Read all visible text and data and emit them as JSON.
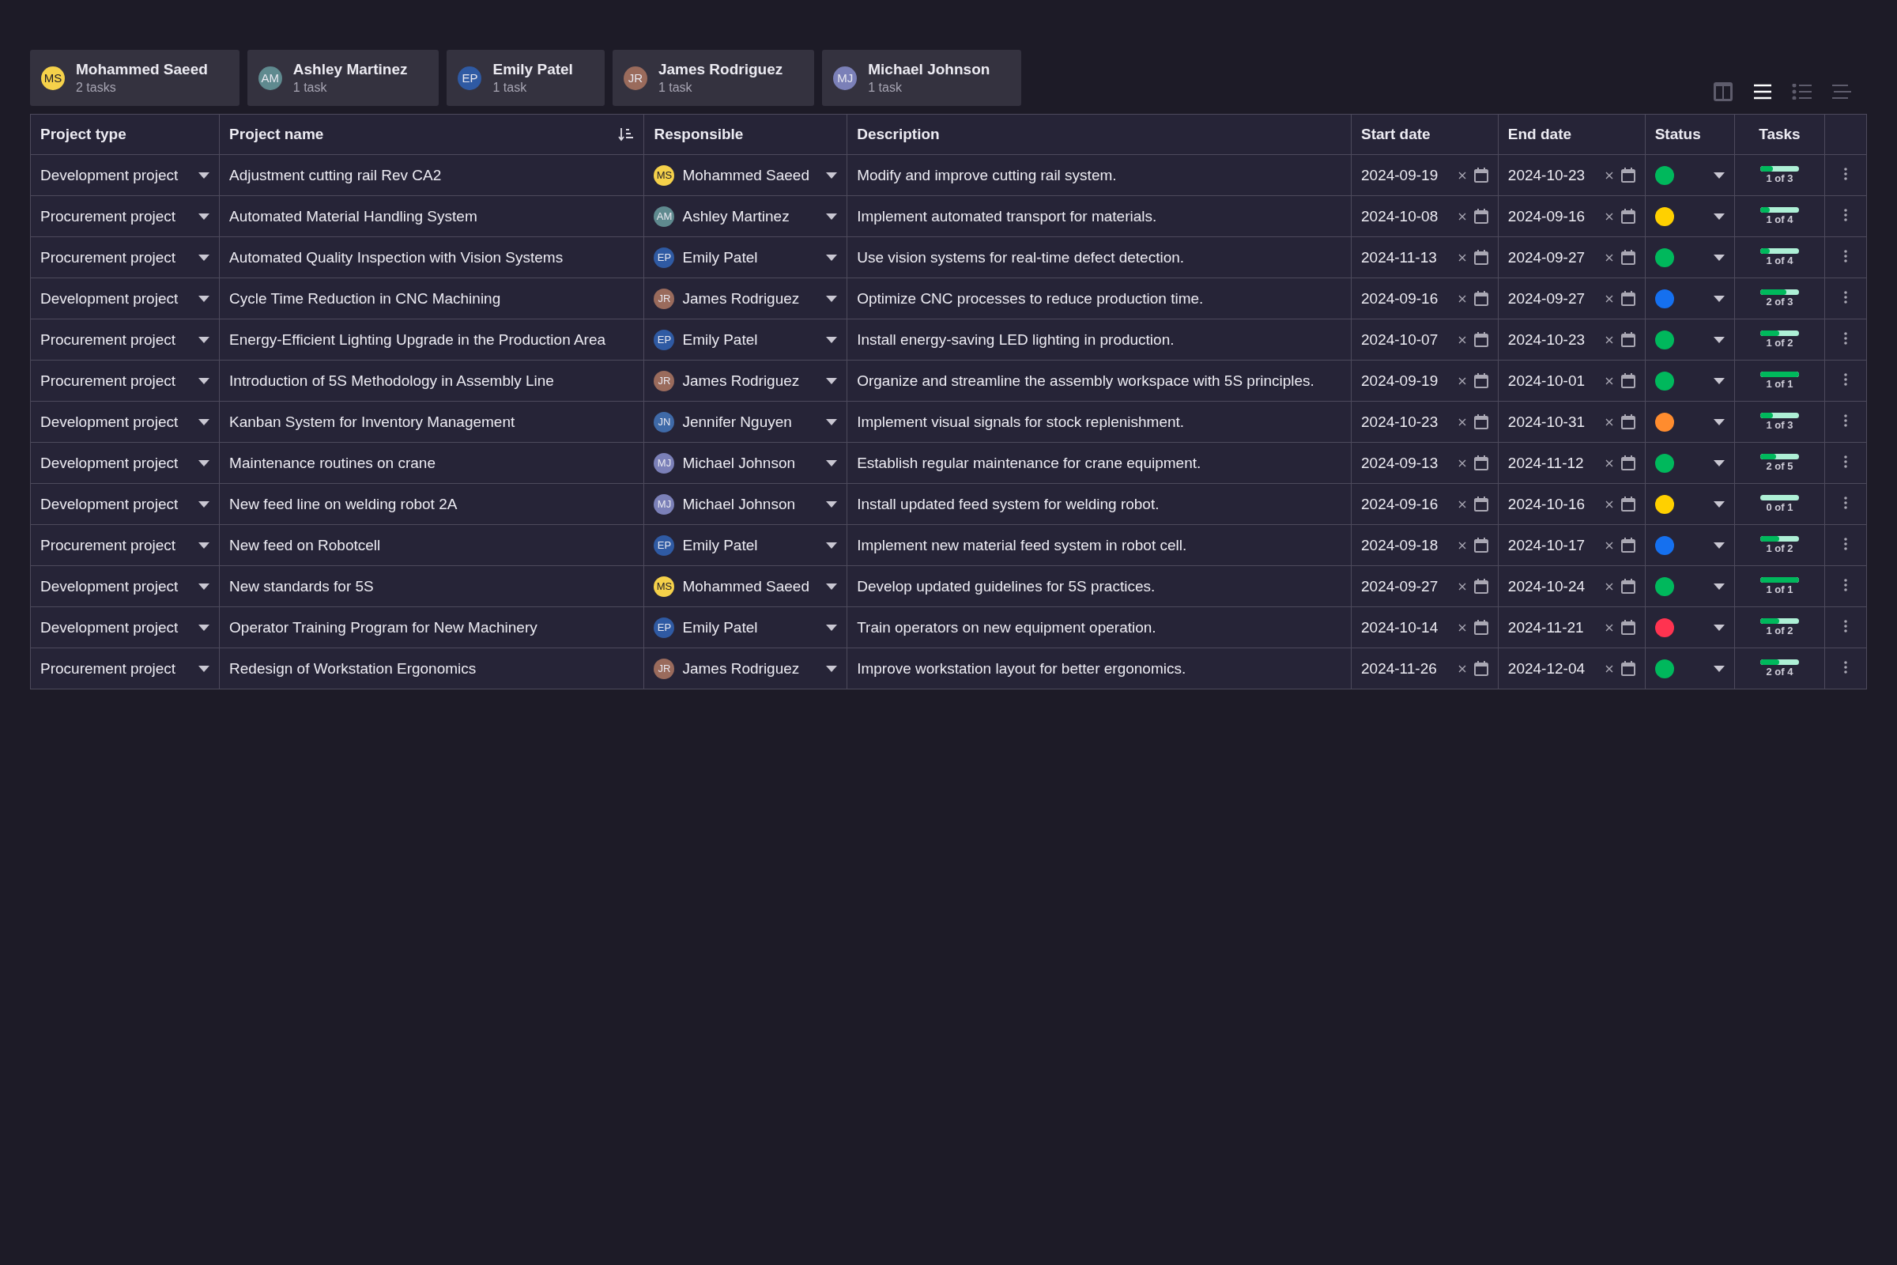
{
  "people": [
    {
      "initials": "MS",
      "name": "Mohammed Saeed",
      "count": "2 tasks",
      "color": "#f5d14a"
    },
    {
      "initials": "AM",
      "name": "Ashley Martinez",
      "count": "1 task",
      "color": "#5f8a8f"
    },
    {
      "initials": "EP",
      "name": "Emily Patel",
      "count": "1 task",
      "color": "#2f5aa3"
    },
    {
      "initials": "JR",
      "name": "James Rodriguez",
      "count": "1 task",
      "color": "#9a6b5c"
    },
    {
      "initials": "MJ",
      "name": "Michael Johnson",
      "count": "1 task",
      "color": "#7b80b8"
    }
  ],
  "views": [
    {
      "kind": "columns",
      "selected": false
    },
    {
      "kind": "rows",
      "selected": true
    },
    {
      "kind": "bullets",
      "selected": false
    },
    {
      "kind": "lines",
      "selected": false
    }
  ],
  "table": {
    "columns": [
      "Project type",
      "Project name",
      "Responsible",
      "Description",
      "Start date",
      "End date",
      "Status",
      "Tasks"
    ],
    "rows": [
      {
        "type": "Development project",
        "name": "Adjustment cutting rail Rev CA2",
        "responsible": {
          "initials": "MS",
          "name": "Mohammed Saeed",
          "color": "#f5d14a"
        },
        "description": "Modify and improve cutting rail system.",
        "start": "2024-09-19",
        "end": "2024-10-23",
        "color": "#00b85c",
        "level": 0.333,
        "tasks": "1 of 3"
      },
      {
        "type": "Procurement project",
        "name": "Automated Material Handling System",
        "responsible": {
          "initials": "AM",
          "name": "Ashley Martinez",
          "color": "#5f8a8f"
        },
        "description": "Implement automated transport for materials.",
        "start": "2024-10-08",
        "end": "2024-09-16",
        "color": "#ffd000",
        "level": 0.25,
        "tasks": "1 of 4"
      },
      {
        "type": "Procurement project",
        "name": "Automated Quality Inspection with Vision Systems",
        "responsible": {
          "initials": "EP",
          "name": "Emily Patel",
          "color": "#2f5aa3"
        },
        "description": "Use vision systems for real-time defect detection.",
        "start": "2024-11-13",
        "end": "2024-09-27",
        "color": "#00b85c",
        "level": 0.25,
        "tasks": "1 of 4"
      },
      {
        "type": "Development project",
        "name": "Cycle Time Reduction in CNC Machining",
        "responsible": {
          "initials": "JR",
          "name": "James Rodriguez",
          "color": "#9a6b5c"
        },
        "description": "Optimize CNC processes to reduce production time.",
        "start": "2024-09-16",
        "end": "2024-09-27",
        "color": "#1570ef",
        "level": 0.667,
        "tasks": "2 of 3"
      },
      {
        "type": "Procurement project",
        "name": "Energy-Efficient Lighting Upgrade in the Production Area",
        "responsible": {
          "initials": "EP",
          "name": "Emily Patel",
          "color": "#2f5aa3"
        },
        "description": "Install energy-saving LED lighting in production.",
        "start": "2024-10-07",
        "end": "2024-10-23",
        "color": "#00b85c",
        "level": 0.5,
        "tasks": "1 of 2"
      },
      {
        "type": "Procurement project",
        "name": "Introduction of 5S Methodology in Assembly Line",
        "responsible": {
          "initials": "JR",
          "name": "James Rodriguez",
          "color": "#9a6b5c"
        },
        "description": "Organize and streamline the assembly workspace with 5S principles.",
        "start": "2024-09-19",
        "end": "2024-10-01",
        "color": "#00b85c",
        "level": 1,
        "tasks": "1 of 1"
      },
      {
        "type": "Development project",
        "name": "Kanban System for Inventory Management",
        "responsible": {
          "initials": "JN",
          "name": "Jennifer Nguyen",
          "color": "#3f6aa8"
        },
        "description": "Implement visual signals for stock replenishment.",
        "start": "2024-10-23",
        "end": "2024-10-31",
        "color": "#ff8c2e",
        "level": 0.333,
        "tasks": "1 of 3"
      },
      {
        "type": "Development project",
        "name": "Maintenance routines on crane",
        "responsible": {
          "initials": "MJ",
          "name": "Michael Johnson",
          "color": "#7b80b8"
        },
        "description": "Establish regular maintenance for crane equipment.",
        "start": "2024-09-13",
        "end": "2024-11-12",
        "color": "#00b85c",
        "level": 0.4,
        "tasks": "2 of 5"
      },
      {
        "type": "Development project",
        "name": "New feed line on welding robot 2A",
        "responsible": {
          "initials": "MJ",
          "name": "Michael Johnson",
          "color": "#7b80b8"
        },
        "description": "Install updated feed system for welding robot.",
        "start": "2024-09-16",
        "end": "2024-10-16",
        "color": "#ffd000",
        "level": 0,
        "tasks": "0 of 1"
      },
      {
        "type": "Procurement project",
        "name": "New feed on Robotcell",
        "responsible": {
          "initials": "EP",
          "name": "Emily Patel",
          "color": "#2f5aa3"
        },
        "description": "Implement new material feed system in robot cell.",
        "start": "2024-09-18",
        "end": "2024-10-17",
        "color": "#1570ef",
        "level": 0.5,
        "tasks": "1 of 2"
      },
      {
        "type": "Development project",
        "name": "New standards for 5S",
        "responsible": {
          "initials": "MS",
          "name": "Mohammed Saeed",
          "color": "#f5d14a"
        },
        "description": "Develop updated guidelines for 5S practices.",
        "start": "2024-09-27",
        "end": "2024-10-24",
        "color": "#00b85c",
        "level": 1,
        "tasks": "1 of 1"
      },
      {
        "type": "Development project",
        "name": "Operator Training Program for New Machinery",
        "responsible": {
          "initials": "EP",
          "name": "Emily Patel",
          "color": "#2f5aa3"
        },
        "description": "Train operators on new equipment operation.",
        "start": "2024-10-14",
        "end": "2024-11-21",
        "color": "#ff3350",
        "level": 0.5,
        "tasks": "1 of 2"
      },
      {
        "type": "Procurement project",
        "name": "Redesign of Workstation Ergonomics",
        "responsible": {
          "initials": "JR",
          "name": "James Rodriguez",
          "color": "#9a6b5c"
        },
        "description": "Improve workstation layout for better ergonomics.",
        "start": "2024-11-26",
        "end": "2024-12-04",
        "color": "#00b85c",
        "level": 0.5,
        "tasks": "2 of 4"
      }
    ]
  }
}
